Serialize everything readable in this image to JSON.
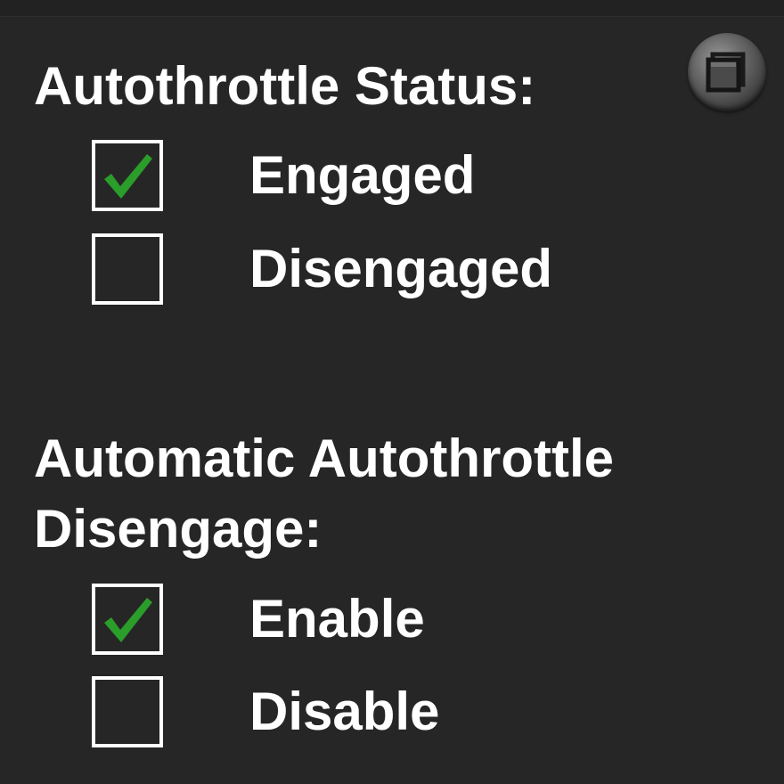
{
  "autothrottle_status": {
    "title": "Autothrottle Status:",
    "options": [
      {
        "label": "Engaged",
        "checked": true
      },
      {
        "label": "Disengaged",
        "checked": false
      }
    ]
  },
  "auto_disengage": {
    "title_line1": "Automatic Autothrottle",
    "title_line2": "Disengage:",
    "options": [
      {
        "label": "Enable",
        "checked": true
      },
      {
        "label": "Disable",
        "checked": false
      }
    ]
  },
  "colors": {
    "background": "#262626",
    "text": "#ffffff",
    "checkmark": "#2a9d2a"
  },
  "icons": {
    "popout": "window-restore-icon",
    "check": "checkmark-icon"
  }
}
